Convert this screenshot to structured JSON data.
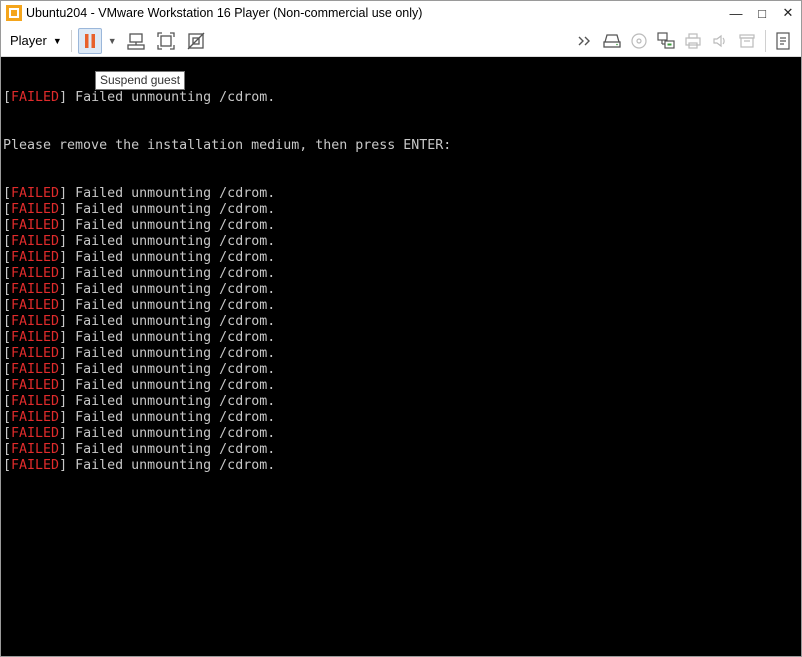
{
  "window": {
    "title": "Ubuntu204 - VMware Workstation 16 Player (Non-commercial use only)",
    "controls": {
      "minimize": "—",
      "maximize": "□",
      "close": "✕"
    }
  },
  "toolbar": {
    "player_label": "Player",
    "tooltip": "Suspend guest",
    "right_icons": [
      "chevron-double-right-icon",
      "removable-drive-icon",
      "cd-icon",
      "network-adapter-icon",
      "printer-icon",
      "audio-icon",
      "usb-icon",
      "notes-icon"
    ]
  },
  "console": {
    "failed_tag": "FAILED",
    "first_line": {
      "message": " Failed unmounting /cdrom."
    },
    "prompt_line": "Please remove the installation medium, then press ENTER:",
    "repeated_lines": [
      " Failed unmounting /cdrom.",
      " Failed unmounting /cdrom.",
      " Failed unmounting /cdrom.",
      " Failed unmounting /cdrom.",
      " Failed unmounting /cdrom.",
      " Failed unmounting /cdrom.",
      " Failed unmounting /cdrom.",
      " Failed unmounting /cdrom.",
      " Failed unmounting /cdrom.",
      " Failed unmounting /cdrom.",
      " Failed unmounting /cdrom.",
      " Failed unmounting /cdrom.",
      " Failed unmounting /cdrom.",
      " Failed unmounting /cdrom.",
      " Failed unmounting /cdrom.",
      " Failed unmounting /cdrom.",
      " Failed unmounting /cdrom.",
      " Failed unmounting /cdrom."
    ]
  },
  "colors": {
    "failed": "#e02b2b",
    "console_text": "#c8c8c8",
    "pause_accent": "#e8612c"
  }
}
